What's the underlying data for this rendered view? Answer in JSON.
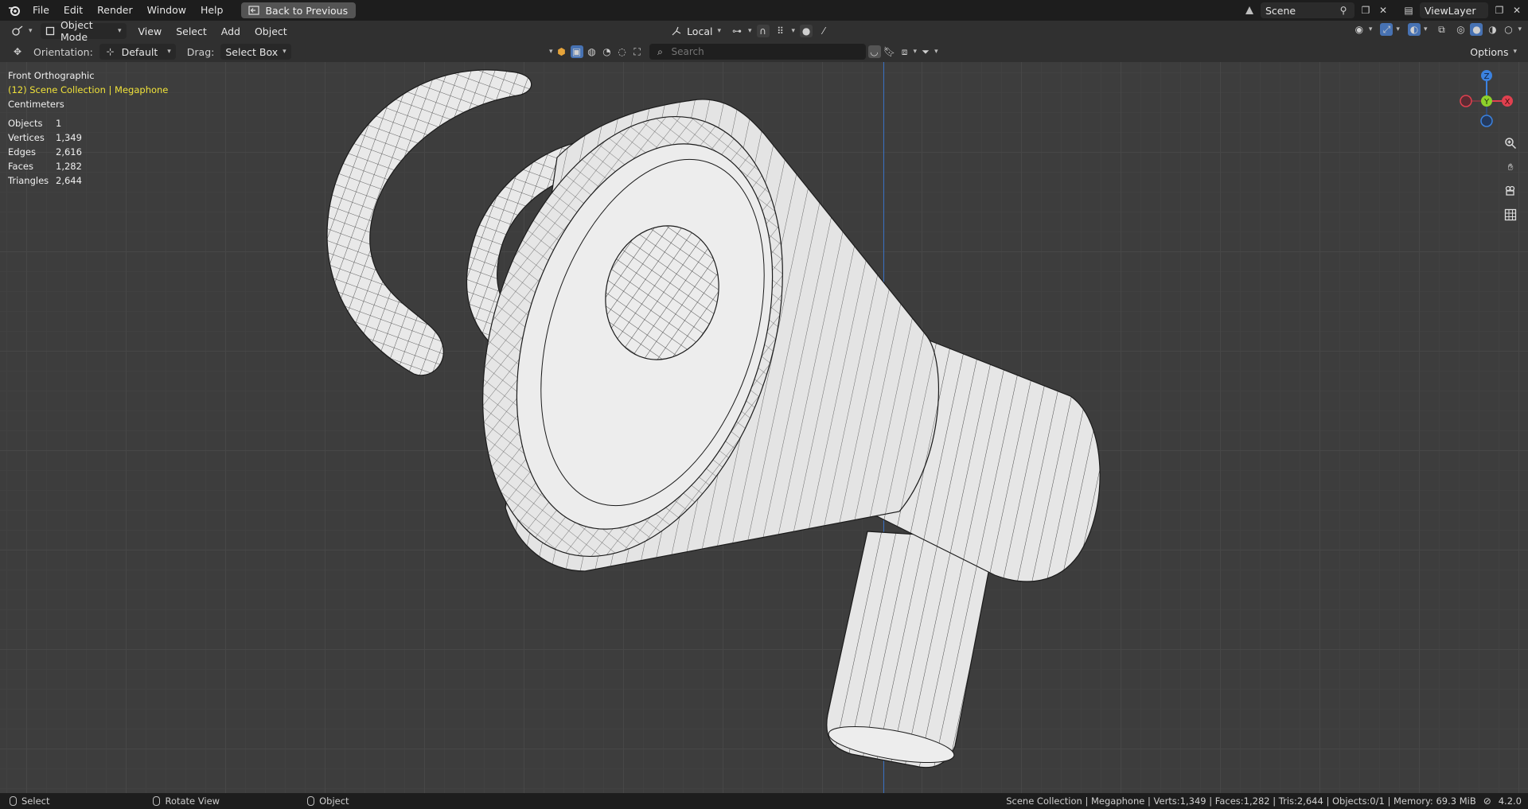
{
  "menubar": {
    "items": [
      "File",
      "Edit",
      "Render",
      "Window",
      "Help"
    ],
    "back_button": "Back to Previous",
    "scene": "Scene",
    "view_layer": "ViewLayer"
  },
  "header": {
    "mode": "Object Mode",
    "menus": [
      "View",
      "Select",
      "Add",
      "Object"
    ],
    "transform_space": "Local",
    "options_label": "Options"
  },
  "tool_settings": {
    "orientation_label": "Orientation:",
    "orientation_value": "Default",
    "drag_label": "Drag:",
    "drag_value": "Select Box",
    "search_placeholder": "Search"
  },
  "overlay": {
    "view_name": "Front Orthographic",
    "collection": "(12) Scene Collection | Megaphone",
    "units": "Centimeters",
    "stats": [
      {
        "label": "Objects",
        "value": "1"
      },
      {
        "label": "Vertices",
        "value": "1,349"
      },
      {
        "label": "Edges",
        "value": "2,616"
      },
      {
        "label": "Faces",
        "value": "1,282"
      },
      {
        "label": "Triangles",
        "value": "2,644"
      }
    ]
  },
  "gizmo": {
    "x_label": "X",
    "y_label": "Y",
    "z_label": "Z"
  },
  "statusbar": {
    "select": "Select",
    "rotate": "Rotate View",
    "object": "Object",
    "info": "Scene Collection | Megaphone | Verts:1,349 | Faces:1,282 | Tris:2,644 | Objects:0/1 | Memory: 69.3 MiB",
    "version": "4.2.0"
  },
  "colors": {
    "axis_x": "#e0404f",
    "axis_y": "#8dd12b",
    "axis_z": "#3b82e0",
    "collection_text": "#f0e23a"
  }
}
